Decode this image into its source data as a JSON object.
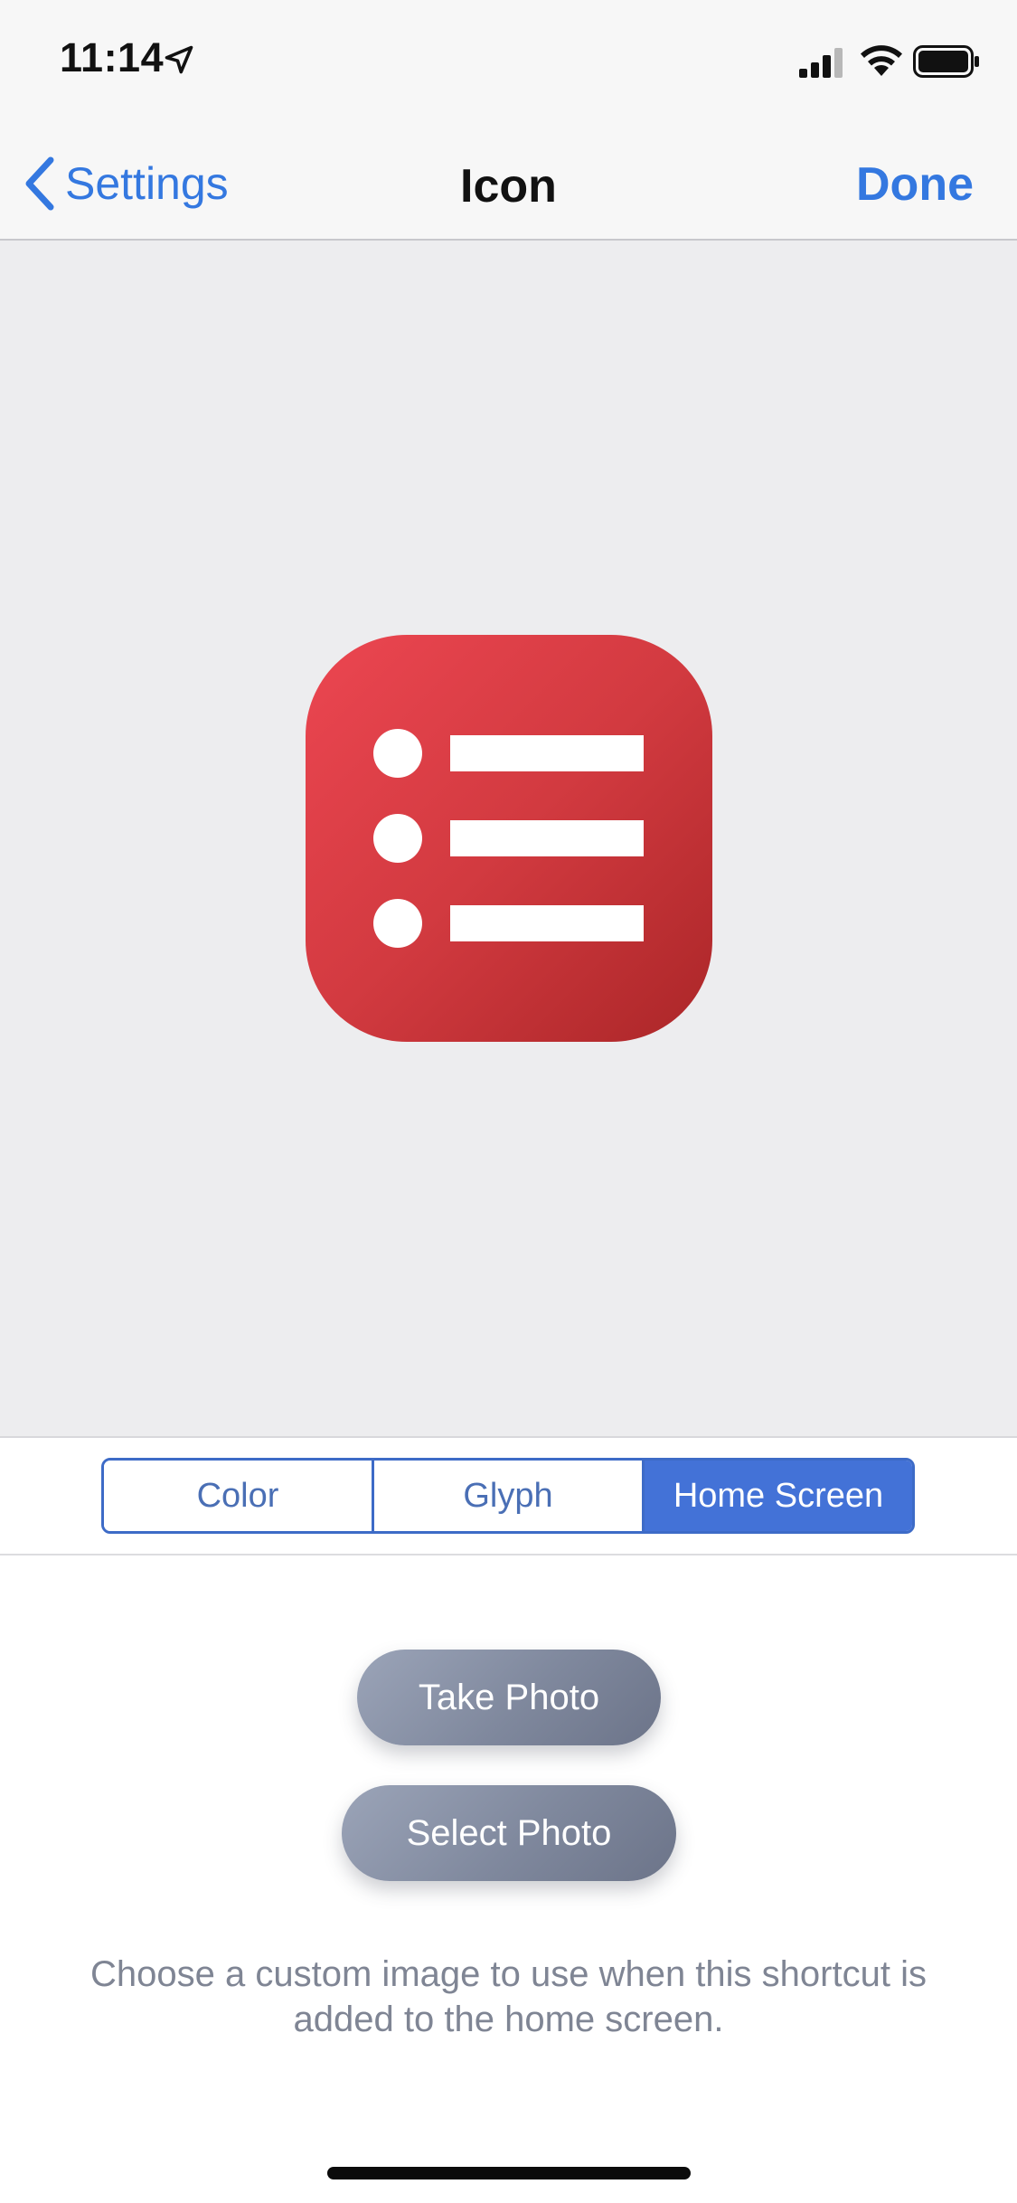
{
  "status_bar": {
    "time": "11:14"
  },
  "nav": {
    "back_label": "Settings",
    "title": "Icon",
    "done_label": "Done"
  },
  "preview": {
    "icon_color": "#d23a40",
    "glyph": "list-icon"
  },
  "segments": {
    "items": [
      "Color",
      "Glyph",
      "Home Screen"
    ],
    "selected": "Home Screen"
  },
  "actions": {
    "take_photo": "Take Photo",
    "select_photo": "Select Photo"
  },
  "helper_text": "Choose a custom image to use when this shortcut is added to the home screen.",
  "colors": {
    "accent": "#3478e0",
    "segment_selected": "#4372d7"
  }
}
